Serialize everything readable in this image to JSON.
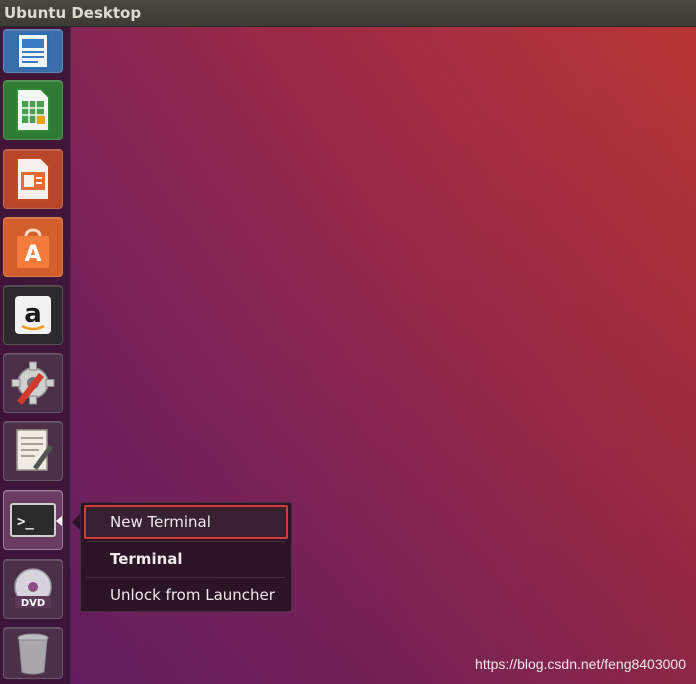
{
  "topbar": {
    "title": "Ubuntu Desktop"
  },
  "launcher": {
    "items": [
      {
        "name": "LibreOffice Writer",
        "icon": "writer-document-icon",
        "color": "#2a6fb3"
      },
      {
        "name": "LibreOffice Calc",
        "icon": "calc-spreadsheet-icon",
        "color": "#2f8a3a"
      },
      {
        "name": "LibreOffice Impress",
        "icon": "impress-presentation-icon",
        "color": "#c14a24"
      },
      {
        "name": "Ubuntu Software",
        "icon": "software-bag-icon",
        "color": "#e9743a",
        "glyph": "A"
      },
      {
        "name": "Amazon",
        "icon": "amazon-icon",
        "color": "#1a1a1a",
        "glyph": "a"
      },
      {
        "name": "System Settings",
        "icon": "settings-gear-icon",
        "color": "#d9d9d9"
      },
      {
        "name": "Text Editor",
        "icon": "text-editor-icon",
        "color": "#e8e4da"
      },
      {
        "name": "Terminal",
        "icon": "terminal-icon",
        "color": "#2b2b2b",
        "glyph": ">_"
      },
      {
        "name": "DVD",
        "icon": "dvd-icon",
        "color": "#c9c6cf",
        "glyph": "DVD"
      },
      {
        "name": "Trash",
        "icon": "trash-icon",
        "color": "#b3b0b5"
      }
    ]
  },
  "context_menu": {
    "items": [
      {
        "label": "New Terminal"
      },
      {
        "label": "Terminal"
      },
      {
        "label": "Unlock from Launcher"
      }
    ]
  },
  "watermark": "https://blog.csdn.net/feng8403000"
}
